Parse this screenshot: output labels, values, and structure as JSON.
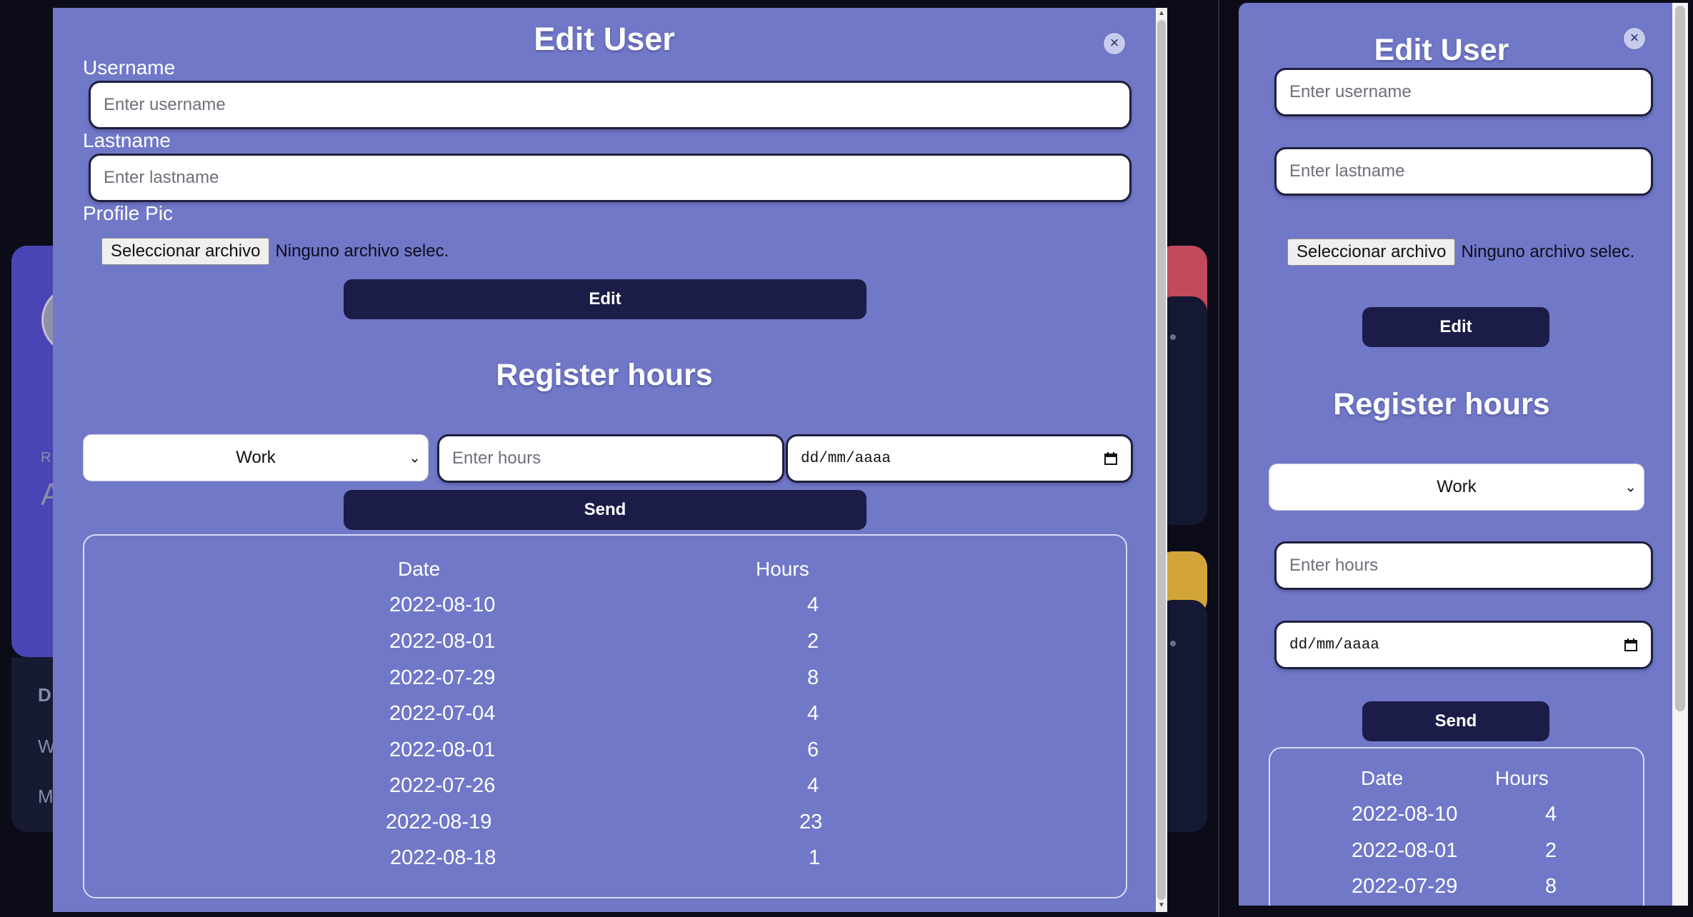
{
  "background": {
    "left_texts": [
      "R",
      "A",
      "D",
      "W",
      "M"
    ]
  },
  "modal1": {
    "title": "Edit User",
    "close_icon": "close-icon",
    "username_label": "Username",
    "username_placeholder": "Enter username",
    "lastname_label": "Lastname",
    "lastname_placeholder": "Enter lastname",
    "profile_pic_label": "Profile Pic",
    "file_button": "Seleccionar archivo",
    "file_status": "Ninguno archivo selec.",
    "edit_button": "Edit",
    "register_title": "Register hours",
    "type_select_value": "Work",
    "hours_placeholder": "Enter hours",
    "date_placeholder": "dd/mm/aaaa",
    "send_button": "Send",
    "table": {
      "headers": [
        "Date",
        "Hours"
      ],
      "rows": [
        [
          "2022-08-10",
          "4"
        ],
        [
          "2022-08-01",
          "2"
        ],
        [
          "2022-07-29",
          "8"
        ],
        [
          "2022-07-04",
          "4"
        ],
        [
          "2022-08-01",
          "6"
        ],
        [
          "2022-07-26",
          "4"
        ],
        [
          "2022-08-19",
          "23"
        ],
        [
          "2022-08-18",
          "1"
        ]
      ]
    }
  },
  "modal2": {
    "title": "Edit User",
    "username_placeholder": "Enter username",
    "lastname_placeholder": "Enter lastname",
    "file_button": "Seleccionar archivo",
    "file_status": "Ninguno archivo selec.",
    "edit_button": "Edit",
    "register_title": "Register hours",
    "type_select_value": "Work",
    "hours_placeholder": "Enter hours",
    "date_placeholder": "dd/mm/aaaa",
    "send_button": "Send",
    "table": {
      "headers": [
        "Date",
        "Hours"
      ],
      "rows": [
        [
          "2022-08-10",
          "4"
        ],
        [
          "2022-08-01",
          "2"
        ],
        [
          "2022-07-29",
          "8"
        ]
      ]
    }
  },
  "colors": {
    "modal_bg": "#7178c8",
    "button_bg": "#1b1d48",
    "page_bg": "#0b0c18"
  }
}
